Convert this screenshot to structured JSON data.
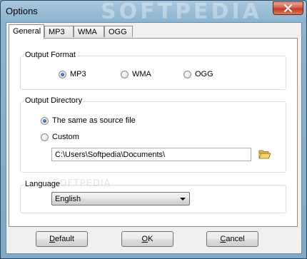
{
  "window": {
    "title": "Options",
    "watermark": "SOFTPEDIA"
  },
  "tabs": [
    {
      "label": "General",
      "active": true
    },
    {
      "label": "MP3",
      "active": false
    },
    {
      "label": "WMA",
      "active": false
    },
    {
      "label": "OGG",
      "active": false
    }
  ],
  "output_format": {
    "label": "Output Format",
    "options": [
      {
        "label": "MP3",
        "checked": true
      },
      {
        "label": "WMA",
        "checked": false
      },
      {
        "label": "OGG",
        "checked": false
      }
    ]
  },
  "output_directory": {
    "label": "Output Directory",
    "same_as_source_label": "The same as source file",
    "custom_label": "Custom",
    "path_value": "C:\\Users\\Softpedia\\Documents\\",
    "browse_icon": "folder-open-icon"
  },
  "language": {
    "label": "Language",
    "selected": "English",
    "watermark": "SOFTPEDIA"
  },
  "buttons": {
    "default": {
      "first": "D",
      "rest": "efault"
    },
    "ok": {
      "first": "O",
      "rest": "K"
    },
    "cancel": {
      "first": "C",
      "rest": "ancel"
    }
  },
  "colors": {
    "radio_checked": "#1c4f9c",
    "close_button": "#c23a22"
  }
}
